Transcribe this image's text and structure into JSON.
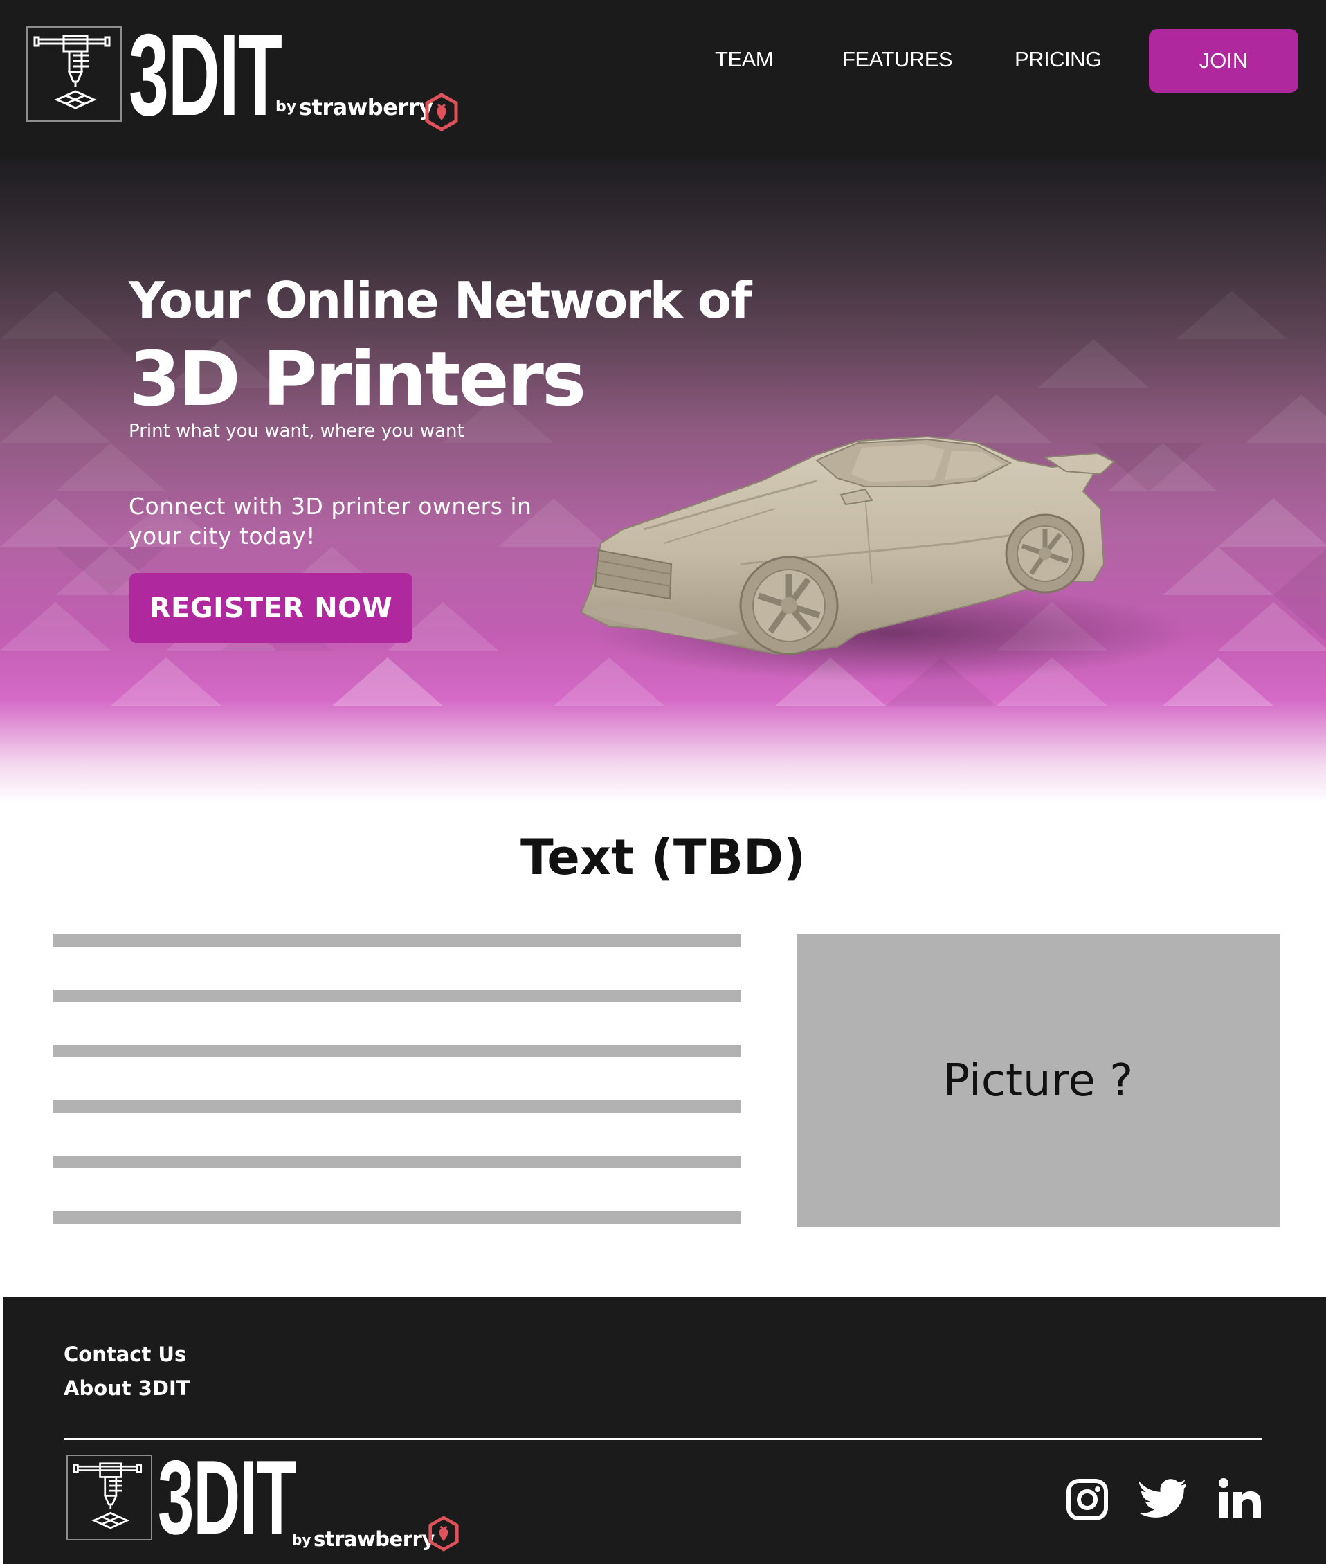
{
  "brand": {
    "name": "3DIT",
    "by": "by",
    "company": "strawberry"
  },
  "nav": {
    "items": [
      "TEAM",
      "FEATURES",
      "PRICING"
    ],
    "join_label": "JOIN"
  },
  "hero": {
    "title_line1": "Your Online Network of",
    "title_line2": "3D Printers",
    "subtitle": "Print what you want, where you want",
    "connect_text": "Connect with 3D printer owners in your city today!",
    "register_label": "REGISTER NOW"
  },
  "content": {
    "section_title": "Text (TBD)",
    "placeholder_line_count": 6,
    "picture_label": "Picture ?"
  },
  "footer": {
    "links": [
      "Contact Us",
      "About 3DIT"
    ],
    "social": [
      "instagram-icon",
      "twitter-icon",
      "linkedin-icon"
    ]
  },
  "colors": {
    "header_bg": "#1b1b1c",
    "accent": "#b0289d",
    "placeholder_gray": "#b2b2b2",
    "strawberry_red": "#e0525a"
  }
}
